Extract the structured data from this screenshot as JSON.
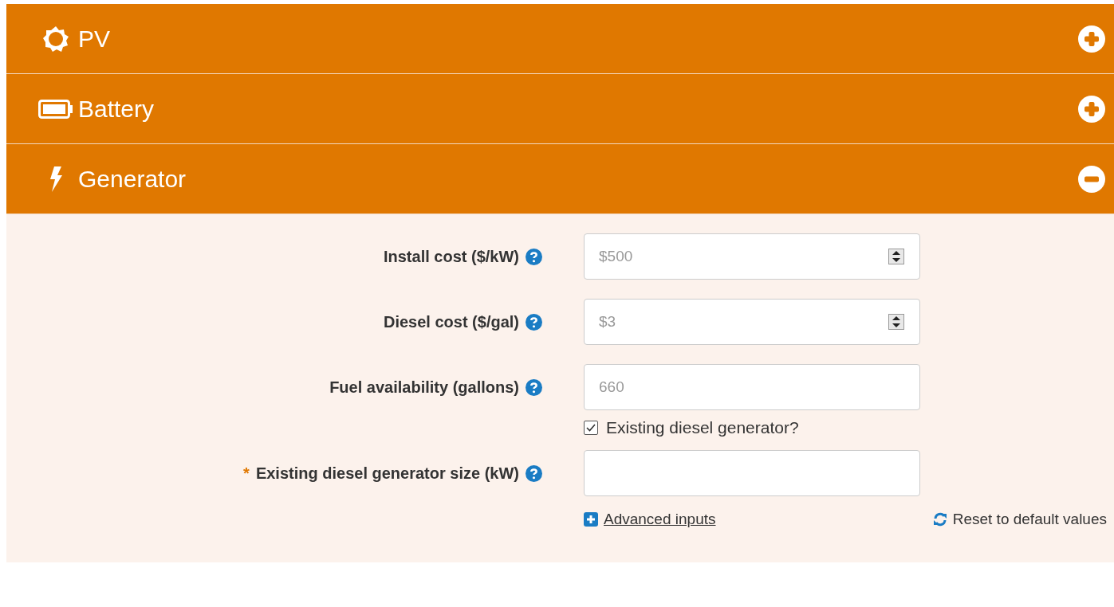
{
  "sections": [
    {
      "title": "PV",
      "expanded": false
    },
    {
      "title": "Battery",
      "expanded": false
    },
    {
      "title": "Generator",
      "expanded": true
    }
  ],
  "fields": [
    {
      "kind": "spinner",
      "label": "Install cost ($/kW)",
      "help": true,
      "placeholder": "$500"
    },
    {
      "kind": "spinner",
      "label": "Diesel cost ($/gal)",
      "help": true,
      "placeholder": "$3"
    },
    {
      "kind": "text",
      "label": "Fuel availability (gallons)",
      "help": true,
      "placeholder": "660"
    },
    {
      "kind": "checkbox",
      "label": "Existing diesel generator?",
      "checked": true
    },
    {
      "kind": "text",
      "label": "Existing diesel generator size (kW)",
      "help": true,
      "required_mark": "*"
    }
  ],
  "advanced_link": "Advanced inputs",
  "reset_link": "Reset to default values"
}
